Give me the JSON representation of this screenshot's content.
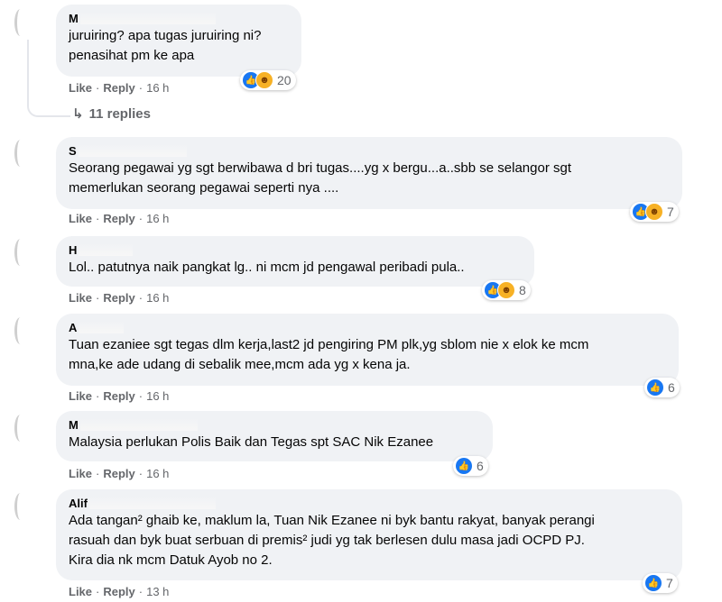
{
  "comments": [
    {
      "author": "M",
      "lines": [
        "juruiring? apa tugas juruiring ni?",
        "penasihat pm ke apa"
      ],
      "like": "Like",
      "reply": "Reply",
      "time": "16 h",
      "reaction_count": "20",
      "reactions": [
        "like-icon",
        "haha-icon"
      ]
    },
    {
      "author": "S",
      "lines": [
        "Seorang pegawai yg sgt berwibawa d bri tugas....yg x bergu...a..sbb se selangor sgt",
        "memerlukan seorang pegawai seperti nya ...."
      ],
      "like": "Like",
      "reply": "Reply",
      "time": "16 h",
      "reaction_count": "7",
      "reactions": [
        "like-icon",
        "haha-icon"
      ]
    },
    {
      "author": "H",
      "lines": [
        "Lol.. patutnya naik pangkat lg.. ni mcm jd pengawal peribadi pula.."
      ],
      "like": "Like",
      "reply": "Reply",
      "time": "16 h",
      "reaction_count": "8",
      "reactions": [
        "like-icon",
        "haha-icon"
      ]
    },
    {
      "author": "A",
      "lines": [
        "Tuan ezaniee sgt tegas dlm kerja,last2 jd pengiring PM plk,yg sblom nie x elok ke mcm",
        "mna,ke ade udang di sebalik mee,mcm ada yg x kena ja."
      ],
      "like": "Like",
      "reply": "Reply",
      "time": "16 h",
      "reaction_count": "6",
      "reactions": [
        "like-icon"
      ]
    },
    {
      "author": "M",
      "lines": [
        "Malaysia perlukan Polis Baik dan Tegas spt SAC Nik Ezanee"
      ],
      "like": "Like",
      "reply": "Reply",
      "time": "16 h",
      "reaction_count": "6",
      "reactions": [
        "like-icon"
      ]
    },
    {
      "author": "Alif",
      "lines": [
        "Ada tangan² ghaib ke, maklum la, Tuan Nik Ezanee ni byk bantu rakyat, banyak perangi",
        "rasuah dan byk buat serbuan di premis² judi yg tak berlesen dulu masa jadi OCPD PJ.",
        "Kira dia nk mcm Datuk Ayob no 2."
      ],
      "like": "Like",
      "reply": "Reply",
      "time": "13 h",
      "reaction_count": "7",
      "reactions": [
        "like-icon"
      ]
    }
  ],
  "replies_label": "11 replies",
  "colors": {
    "bubble": "#f0f2f5",
    "meta": "#65676b",
    "like_blue": "#1877f2",
    "haha_yellow": "#f7b125"
  }
}
